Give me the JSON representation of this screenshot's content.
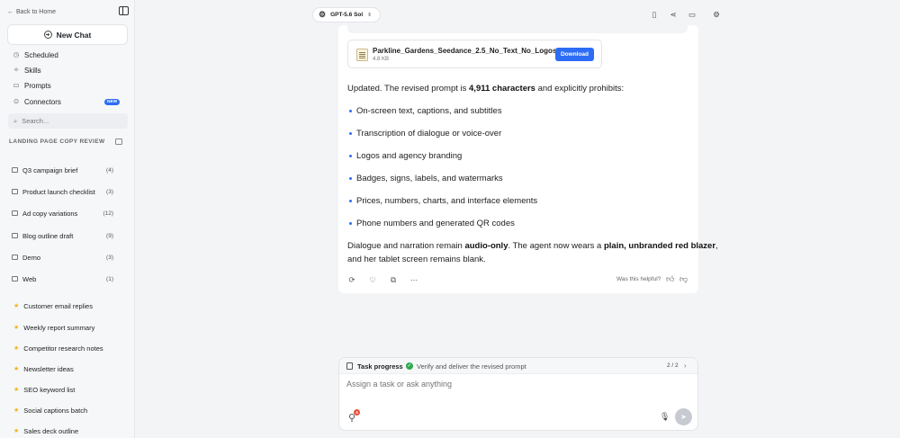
{
  "sidebar": {
    "back_label": "Back to Home",
    "new_chat_label": "New Chat",
    "nav": [
      {
        "label": "Scheduled",
        "icon": "clock-icon"
      },
      {
        "label": "Skills",
        "icon": "sparkle-icon"
      },
      {
        "label": "Prompts",
        "icon": "book-icon"
      },
      {
        "label": "Connectors",
        "icon": "plug-icon"
      }
    ],
    "new_badge": "NEW",
    "search_placeholder": "Search...",
    "section_title": "LANDING PAGE COPY REVIEW",
    "folders": [
      {
        "label": "Q3 campaign brief",
        "count": "(4)"
      },
      {
        "label": "Product launch checklist",
        "count": "(3)"
      },
      {
        "label": "Ad copy variations",
        "count": "(12)"
      },
      {
        "label": "Blog outline draft",
        "count": "(9)"
      },
      {
        "label": "Demo",
        "count": "(3)"
      },
      {
        "label": "Web",
        "count": "(1)"
      }
    ],
    "starred": [
      "Customer email replies",
      "Weekly report summary",
      "Competitor research notes",
      "Newsletter ideas",
      "SEO keyword list",
      "Social captions batch",
      "Sales deck outline"
    ]
  },
  "toolbar": {
    "model_label": "GPT-5.6 Sol",
    "icons": [
      "book-icon",
      "share-icon",
      "monitor-icon",
      "settings-icon"
    ]
  },
  "message": {
    "file": {
      "name": "Parkline_Gardens_Seedance_2.5_No_Text_No_Logos.txt",
      "size": "4.8 KB",
      "download_label": "Download"
    },
    "intro_pre": "Updated. The revised prompt is ",
    "intro_bold": "4,911 characters",
    "intro_post": " and explicitly prohibits:",
    "bullets": [
      "On-screen text, captions, and subtitles",
      "Transcription of dialogue or voice-over",
      "Logos and agency branding",
      "Badges, signs, labels, and watermarks",
      "Prices, numbers, charts, and interface elements",
      "Phone numbers and generated QR codes"
    ],
    "outro_1": "Dialogue and narration remain ",
    "outro_bold_1": "audio-only",
    "outro_2": ". The agent now wears a ",
    "outro_bold_2": "plain, unbranded red blazer",
    "outro_3": ",",
    "outro_line2": "and her tablet screen remains blank.",
    "helpful_label": "Was this helpful?"
  },
  "composer": {
    "task_label": "Task progress",
    "task_step": "Verify and deliver the revised prompt",
    "task_count": "2 / 2",
    "placeholder": "Assign a task or ask anything",
    "attach_badge": "4"
  }
}
